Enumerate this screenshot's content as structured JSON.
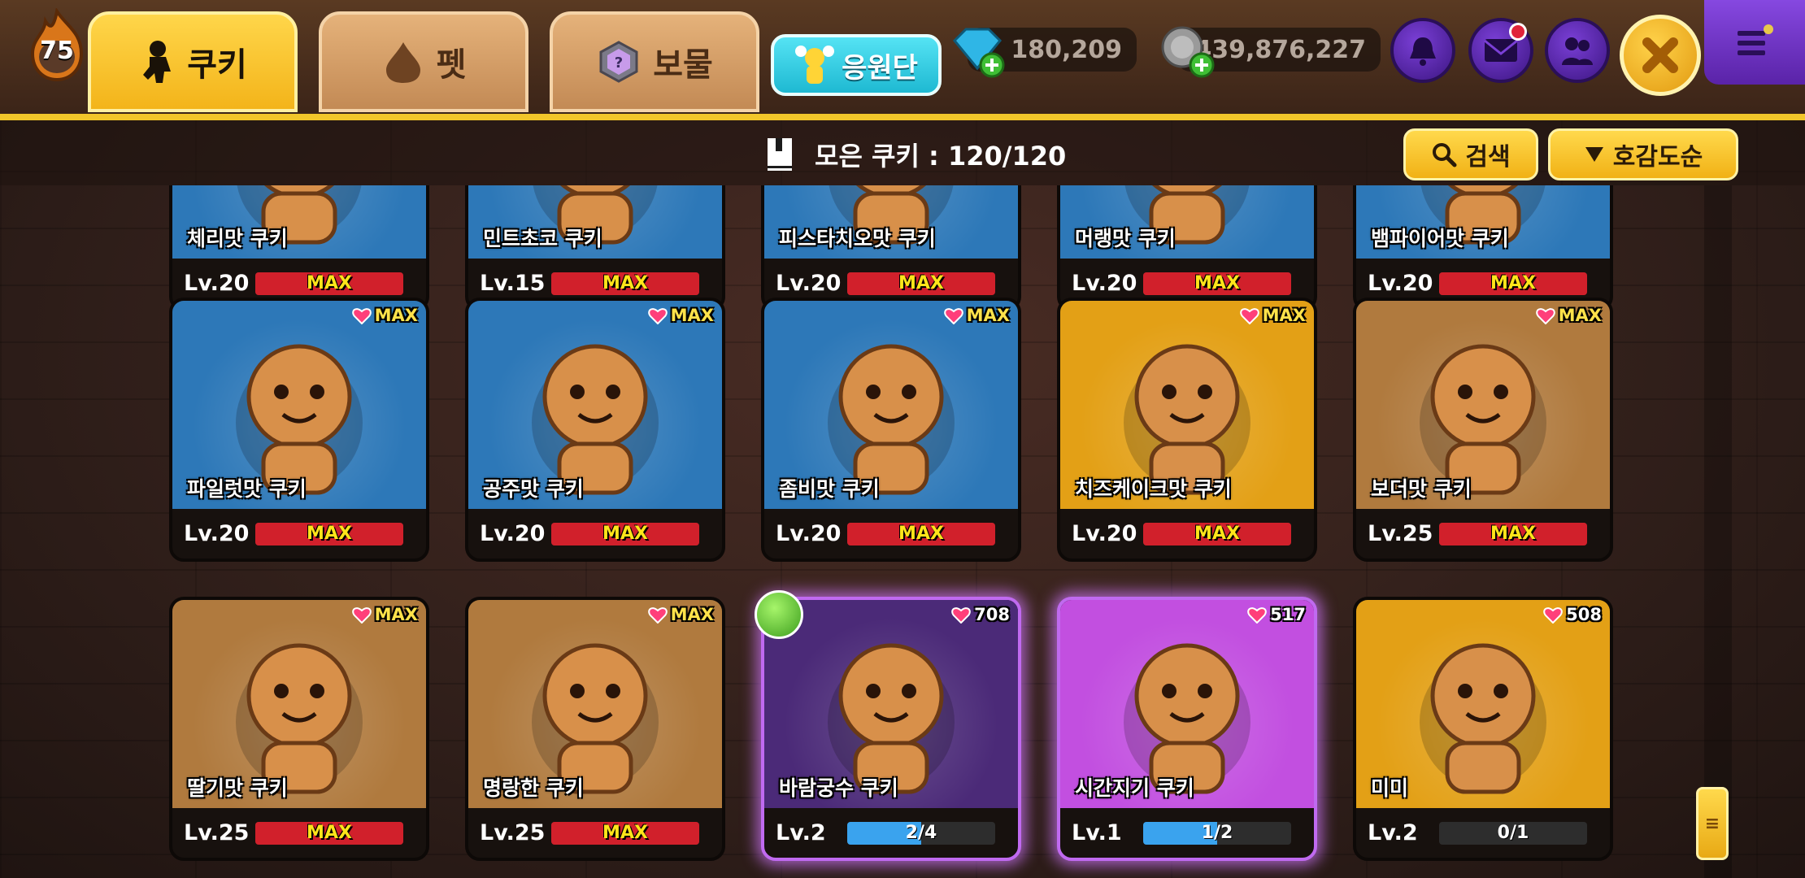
{
  "header": {
    "player_level": "75",
    "tabs": [
      {
        "label": "쿠키",
        "active": true
      },
      {
        "label": "펫",
        "active": false
      },
      {
        "label": "보물",
        "active": false
      }
    ],
    "cheer_label": "응원단",
    "crystals": "180,209",
    "coins": "439,876,227"
  },
  "toolbar": {
    "collected_label": "모은 쿠키 : 120/120",
    "search_label": "검색",
    "sort_label": "호감도순"
  },
  "cards_top": [
    {
      "name": "체리맛 쿠키",
      "level": "Lv.20",
      "bar": "MAX"
    },
    {
      "name": "민트초코 쿠키",
      "level": "Lv.15",
      "bar": "MAX"
    },
    {
      "name": "피스타치오맛 쿠키",
      "level": "Lv.20",
      "bar": "MAX"
    },
    {
      "name": "머랭맛 쿠키",
      "level": "Lv.20",
      "bar": "MAX"
    },
    {
      "name": "뱀파이어맛 쿠키",
      "level": "Lv.20",
      "bar": "MAX"
    }
  ],
  "cards_mid": [
    {
      "name": "파일럿맛 쿠키",
      "level": "Lv.20",
      "bar": "MAX",
      "affinity": "MAX",
      "color": "#2d78b8"
    },
    {
      "name": "공주맛 쿠키",
      "level": "Lv.20",
      "bar": "MAX",
      "affinity": "MAX",
      "color": "#2d78b8"
    },
    {
      "name": "좀비맛 쿠키",
      "level": "Lv.20",
      "bar": "MAX",
      "affinity": "MAX",
      "color": "#2d78b8"
    },
    {
      "name": "치즈케이크맛 쿠키",
      "level": "Lv.20",
      "bar": "MAX",
      "affinity": "MAX",
      "color": "#e3a016"
    },
    {
      "name": "보더맛 쿠키",
      "level": "Lv.25",
      "bar": "MAX",
      "affinity": "MAX",
      "color": "#b07a3e"
    }
  ],
  "cards_bot": [
    {
      "name": "딸기맛 쿠키",
      "level": "Lv.25",
      "bar": "MAX",
      "affinity": "MAX",
      "color": "#b07a3e",
      "progress": 1.0
    },
    {
      "name": "명랑한 쿠키",
      "level": "Lv.25",
      "bar": "MAX",
      "affinity": "MAX",
      "color": "#b07a3e",
      "progress": 1.0
    },
    {
      "name": "바람궁수 쿠키",
      "level": "Lv.2",
      "bar": "2/4",
      "affinity": "708",
      "color": "#4b2a78",
      "progress": 0.5
    },
    {
      "name": "시간지기 쿠키",
      "level": "Lv.1",
      "bar": "1/2",
      "affinity": "517",
      "color": "#c24fe0",
      "progress": 0.5
    },
    {
      "name": "미미",
      "level": "Lv.2",
      "bar": "0/1",
      "affinity": "508",
      "color": "#e3a016",
      "progress": 0.0
    }
  ],
  "icons": [
    "flame-level-icon",
    "cookie-icon",
    "pet-drop-icon",
    "treasure-icon",
    "cheer-icon",
    "crystal-icon",
    "coin-icon",
    "bell-icon",
    "mail-icon",
    "friends-icon",
    "close-icon",
    "menu-icon",
    "book-icon",
    "search-icon",
    "sort-down-icon",
    "heart-icon"
  ],
  "colors": {
    "accent": "#f2c62a",
    "max_bar": "#d1202b",
    "progress_bar": "#3aa3ee",
    "heart": "#ff3f7a"
  }
}
